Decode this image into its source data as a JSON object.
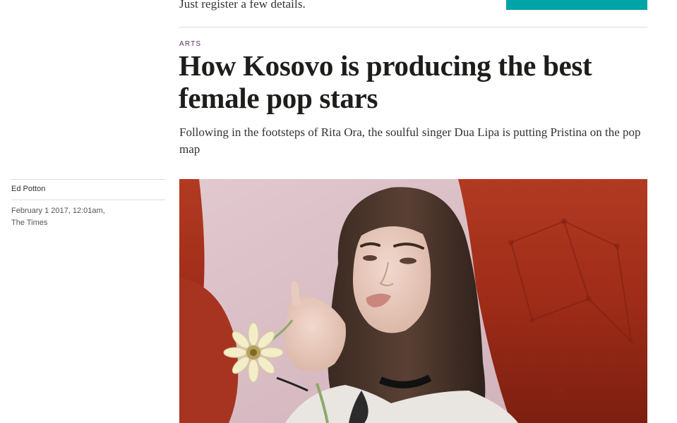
{
  "promo": {
    "register_text": "Just register a few details."
  },
  "article": {
    "section": "ARTS",
    "headline": "How Kosovo is producing the best female pop stars",
    "standfirst": "Following in the footsteps of Rita Ora, the soulful singer Dua Lipa is putting Pristina on the pop map",
    "author": "Ed Potton",
    "date": "February 1 2017, 12:01am,",
    "publication": "The Times"
  },
  "colors": {
    "accent_teal": "#00a3a7",
    "section_purple": "#5a2d6e"
  }
}
